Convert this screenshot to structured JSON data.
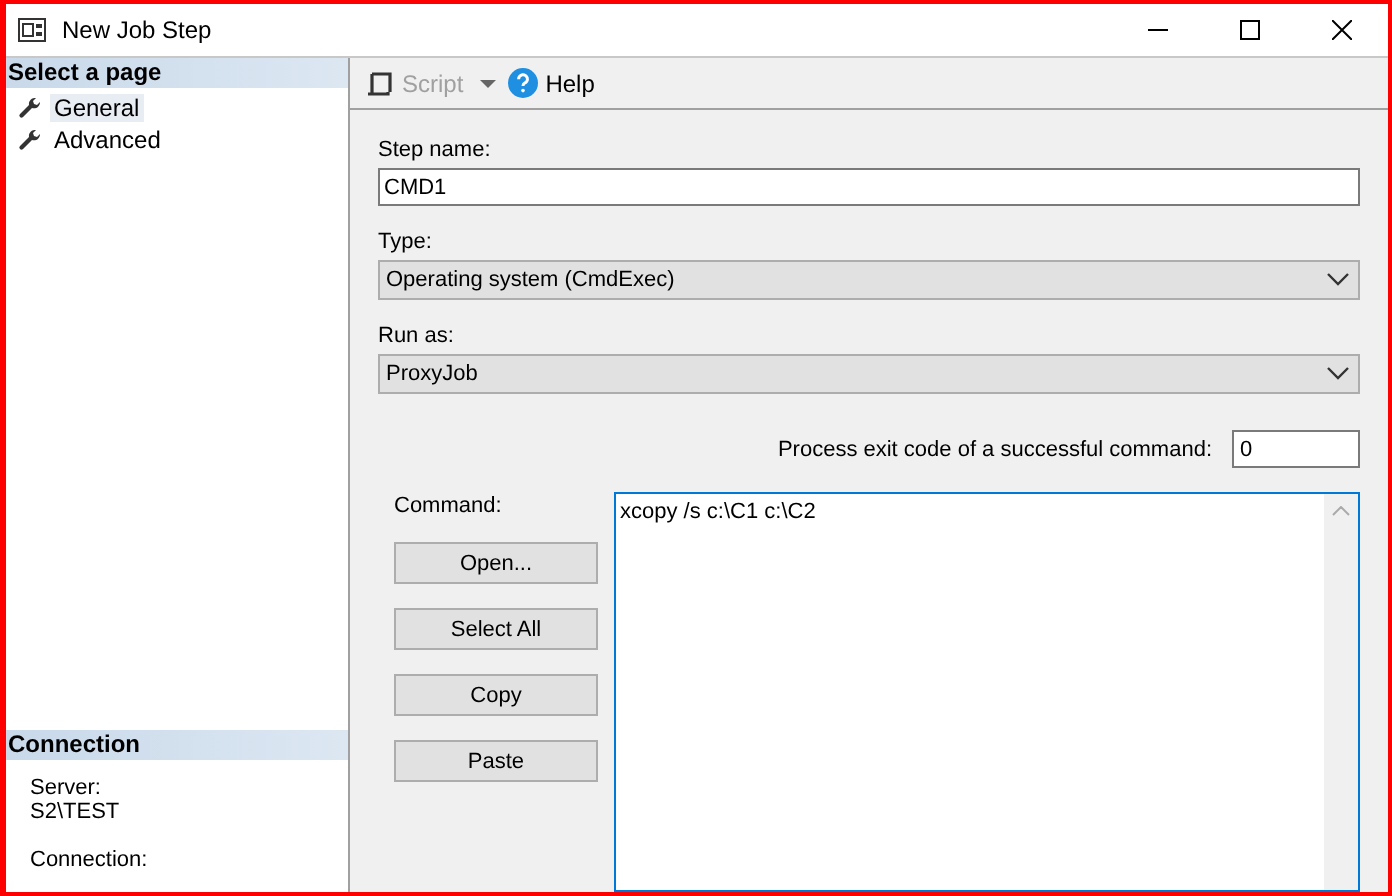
{
  "window": {
    "title": "New Job Step"
  },
  "sidebar": {
    "header": "Select a page",
    "pages": [
      {
        "label": "General",
        "selected": true
      },
      {
        "label": "Advanced",
        "selected": false
      }
    ],
    "connection": {
      "header": "Connection",
      "fields": [
        {
          "label": "Server:",
          "value": "S2\\TEST"
        },
        {
          "label": "Connection:"
        }
      ]
    }
  },
  "toolbar": {
    "items": [
      {
        "kind": "script",
        "label": "Script",
        "disabled": true
      },
      {
        "kind": "help",
        "label": "Help",
        "disabled": false
      }
    ]
  },
  "form": {
    "step_name": {
      "label": "Step name:",
      "value": "CMD1"
    },
    "type": {
      "label": "Type:",
      "value": "Operating system (CmdExec)"
    },
    "run_as": {
      "label": "Run as:",
      "value": "ProxyJob"
    },
    "exit_code": {
      "label": "Process exit code of a successful command:",
      "value": "0"
    },
    "command": {
      "label": "Command:",
      "value": "xcopy /s c:\\C1 c:\\C2",
      "buttons": [
        "Open...",
        "Select All",
        "Copy",
        "Paste"
      ]
    }
  }
}
